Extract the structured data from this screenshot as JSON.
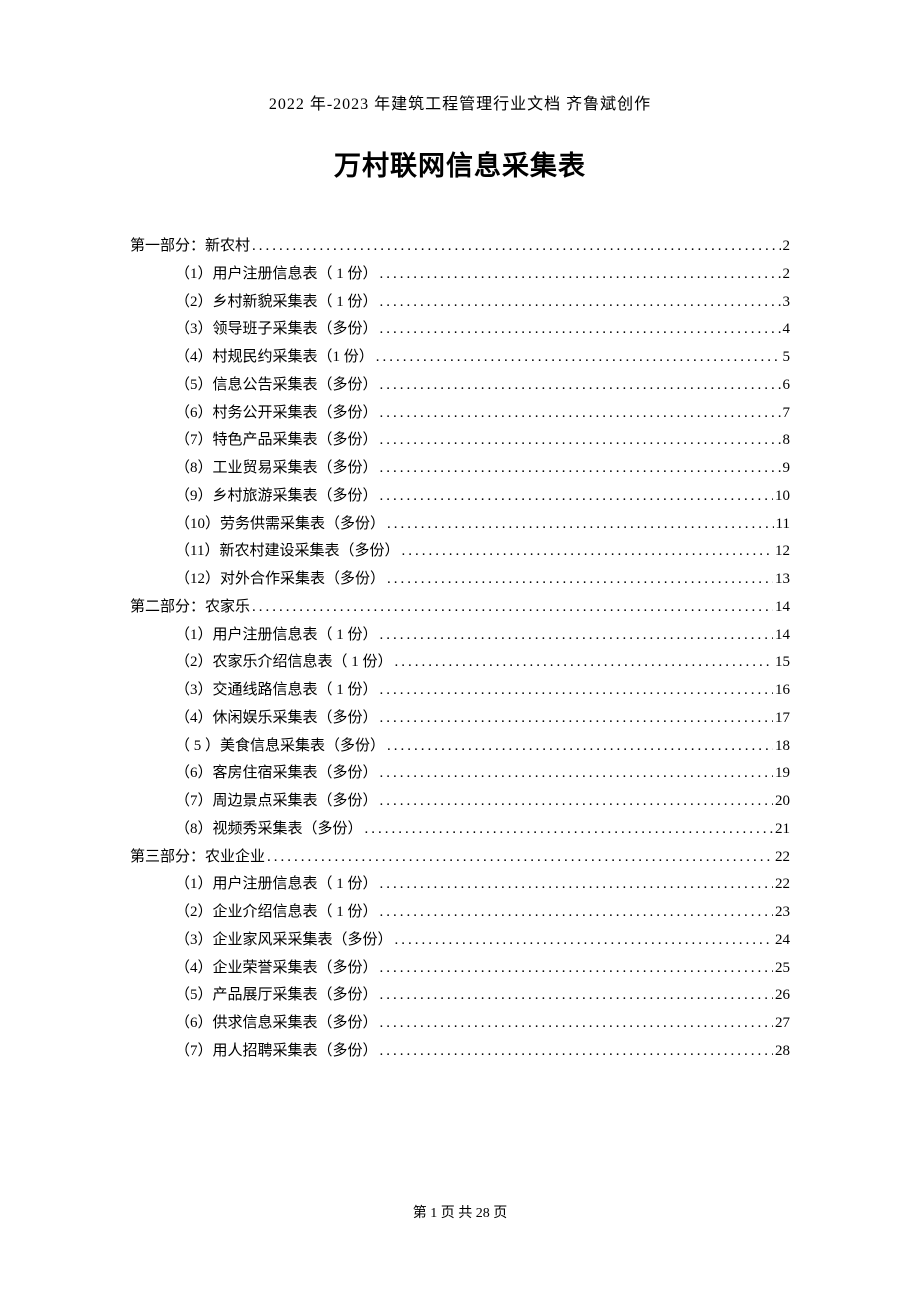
{
  "header": "2022 年-2023 年建筑工程管理行业文档  齐鲁斌创作",
  "title": "万村联网信息采集表",
  "toc": [
    {
      "level": 1,
      "label": "第一部分：新农村",
      "page": "2"
    },
    {
      "level": 2,
      "label": "（1）用户注册信息表（ 1 份）",
      "page": "2"
    },
    {
      "level": 2,
      "label": "（2）乡村新貌采集表（ 1 份）",
      "page": "3"
    },
    {
      "level": 2,
      "label": "（3）领导班子采集表（多份）",
      "page": "4"
    },
    {
      "level": 2,
      "label": "（4）村规民约采集表（1 份）",
      "page": "5"
    },
    {
      "level": 2,
      "label": "（5）信息公告采集表（多份）",
      "page": "6"
    },
    {
      "level": 2,
      "label": "（6）村务公开采集表（多份）",
      "page": "7"
    },
    {
      "level": 2,
      "label": "（7）特色产品采集表（多份）",
      "page": "8"
    },
    {
      "level": 2,
      "label": "（8）工业贸易采集表（多份）",
      "page": "9"
    },
    {
      "level": 2,
      "label": "（9）乡村旅游采集表（多份）",
      "page": "10"
    },
    {
      "level": 2,
      "label": "（10）劳务供需采集表（多份）",
      "page": "11"
    },
    {
      "level": 2,
      "label": "（11）新农村建设采集表（多份）",
      "page": "12"
    },
    {
      "level": 2,
      "label": "（12）对外合作采集表（多份）",
      "page": "13"
    },
    {
      "level": 1,
      "label": "第二部分：农家乐",
      "page": "14"
    },
    {
      "level": 2,
      "label": "（1）用户注册信息表（ 1 份）",
      "page": "14"
    },
    {
      "level": 2,
      "label": "（2）农家乐介绍信息表（ 1 份）",
      "page": "15"
    },
    {
      "level": 2,
      "label": "（3）交通线路信息表（ 1 份）",
      "page": "16"
    },
    {
      "level": 2,
      "label": "（4）休闲娱乐采集表（多份）",
      "page": "17"
    },
    {
      "level": 2,
      "label": "（ 5 ）美食信息采集表（多份）",
      "page": "18"
    },
    {
      "level": 2,
      "label": "（6）客房住宿采集表（多份）",
      "page": "19"
    },
    {
      "level": 2,
      "label": "（7）周边景点采集表（多份）",
      "page": "20"
    },
    {
      "level": 2,
      "label": "（8）视频秀采集表（多份）",
      "page": "21"
    },
    {
      "level": 1,
      "label": "第三部分：农业企业",
      "page": "22"
    },
    {
      "level": 2,
      "label": "（1）用户注册信息表（ 1 份）",
      "page": "22"
    },
    {
      "level": 2,
      "label": "（2）企业介绍信息表（ 1 份）",
      "page": "23"
    },
    {
      "level": 2,
      "label": "（3）企业家风采采集表（多份）",
      "page": "24"
    },
    {
      "level": 2,
      "label": "（4）企业荣誉采集表（多份）",
      "page": "25"
    },
    {
      "level": 2,
      "label": "（5）产品展厅采集表（多份）",
      "page": "26"
    },
    {
      "level": 2,
      "label": "（6）供求信息采集表（多份）",
      "page": "27"
    },
    {
      "level": 2,
      "label": "（7）用人招聘采集表（多份）",
      "page": "28"
    }
  ],
  "footer": "第 1 页 共 28 页"
}
